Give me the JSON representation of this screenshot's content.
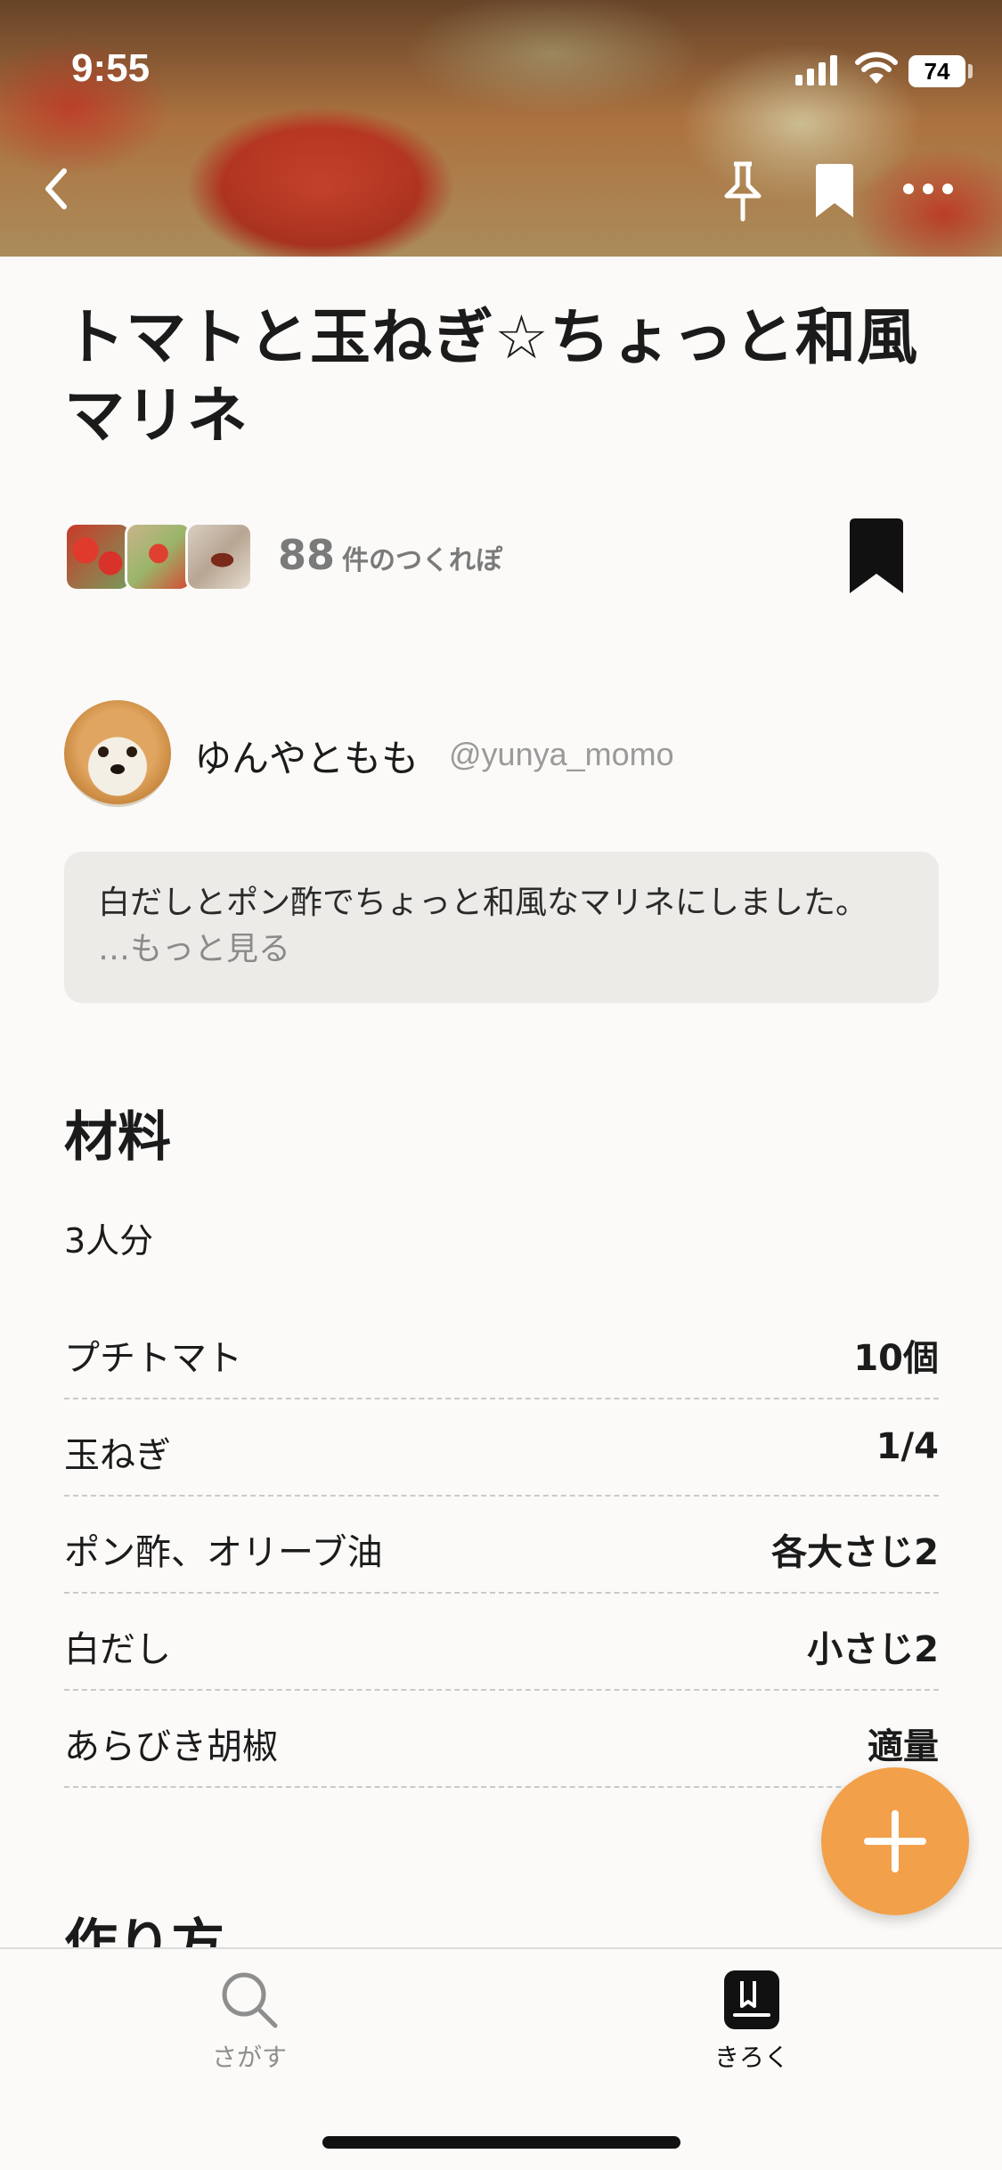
{
  "status_bar": {
    "time": "9:55",
    "battery": "74"
  },
  "recipe": {
    "title": "トマトと玉ねぎ☆ちょっと和風マリネ",
    "reports_count": "88",
    "reports_label": "件のつくれぽ",
    "author_name": "ゆんやともも",
    "author_handle": "@yunya_momo",
    "description": "白だしとポン酢でちょっと和風なマリネにしました。",
    "more_link": "…もっと見る"
  },
  "ingredients": {
    "heading": "材料",
    "servings": "3人分",
    "items": [
      {
        "name": "プチトマト",
        "qty": "10個"
      },
      {
        "name": "玉ねぎ",
        "qty": "1/4"
      },
      {
        "name": "ポン酢、オリーブ油",
        "qty": "各大さじ2"
      },
      {
        "name": "白だし",
        "qty": "小さじ2"
      },
      {
        "name": "あらびき胡椒",
        "qty": "適量"
      }
    ]
  },
  "steps": {
    "heading": "作り方"
  },
  "tabbar": {
    "search_label": "さがす",
    "record_label": "きろく"
  },
  "icons": [
    "back-icon",
    "pin-icon",
    "bookmark-icon",
    "more-icon",
    "search-icon",
    "book-icon",
    "plus-icon"
  ],
  "colors": {
    "accent": "#f2a04a",
    "text": "#1b1b1b",
    "muted": "#8a8a8a",
    "card": "#ecebe8"
  }
}
